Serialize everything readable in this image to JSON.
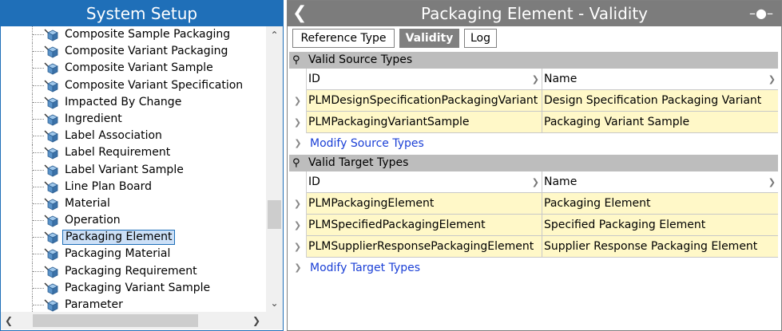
{
  "left": {
    "title": "System Setup",
    "tree_items": [
      "Composite Sample Packaging",
      "Composite Variant Packaging",
      "Composite Variant Sample",
      "Composite Variant Specification",
      "Impacted By Change",
      "Ingredient",
      "Label Association",
      "Label Requirement",
      "Label Variant Sample",
      "Line Plan Board",
      "Material",
      "Operation",
      "Packaging Element",
      "Packaging Material",
      "Packaging Requirement",
      "Packaging Variant Sample",
      "Parameter"
    ],
    "selected": "Packaging Element"
  },
  "right": {
    "title": "Packaging Element - Validity",
    "tabs": [
      "Reference Type",
      "Validity",
      "Log"
    ],
    "active_tab": "Validity",
    "source": {
      "header": "Valid Source Types",
      "col_id": "ID",
      "col_name": "Name",
      "rows": [
        {
          "id": "PLMDesignSpecificationPackagingVariant",
          "name": "Design Specification Packaging Variant"
        },
        {
          "id": "PLMPackagingVariantSample",
          "name": "Packaging Variant Sample"
        }
      ],
      "modify": "Modify Source Types"
    },
    "target": {
      "header": "Valid Target Types",
      "col_id": "ID",
      "col_name": "Name",
      "rows": [
        {
          "id": "PLMPackagingElement",
          "name": "Packaging Element"
        },
        {
          "id": "PLMSpecifiedPackagingElement",
          "name": "Specified Packaging Element"
        },
        {
          "id": "PLMSupplierResponsePackagingElement",
          "name": "Supplier Response Packaging Element"
        }
      ],
      "modify": "Modify Target Types"
    }
  },
  "icons": {
    "back": "back-arrow-icon",
    "pin": "pin-icon",
    "node": "cube-node-icon",
    "scroll_up": "chevron-up-icon",
    "scroll_down": "chevron-down-icon",
    "scroll_left": "chevron-left-icon",
    "scroll_right": "chevron-right-icon"
  },
  "colors": {
    "left_title_bg": "#1f6fb8",
    "right_title_bg": "#7c7c7c",
    "row_highlight": "#fff8c8",
    "link": "#1a3fd6"
  }
}
